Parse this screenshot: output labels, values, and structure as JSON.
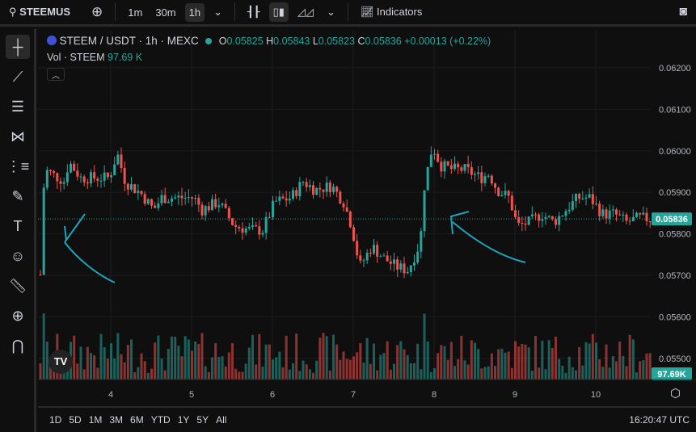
{
  "toolbar": {
    "symbol": "STEEMUS",
    "intervals": [
      "1m",
      "30m",
      "1h"
    ],
    "active_interval": "1h",
    "indicators_label": "Indicators"
  },
  "legend": {
    "title": "STEEM / USDT · 1h · MEXC",
    "o_label": "O",
    "o": "0.05825",
    "h_label": "H",
    "h": "0.05843",
    "l_label": "L",
    "l": "0.05823",
    "c_label": "C",
    "c": "0.05836",
    "change": "+0.00013 (+0.22%)",
    "vol_label": "Vol · STEEM",
    "vol": "97.69 K"
  },
  "left_tools": [
    "crosshair-icon",
    "trendline-icon",
    "fib-icon",
    "pattern-icon",
    "forecast-icon",
    "brush-icon",
    "text-icon",
    "emoji-icon",
    "ruler-icon",
    "zoom-in-icon",
    "magnet-icon"
  ],
  "colors": {
    "up": "#26a69a",
    "down": "#ef5350",
    "annotation": "#1fa3b8",
    "background": "#0f0f0f"
  },
  "chart_data": {
    "type": "candlestick",
    "x_ticks": [
      "4",
      "5",
      "6",
      "7",
      "8",
      "9",
      "10"
    ],
    "y_ticks": [
      "0.06200",
      "0.06100",
      "0.06000",
      "0.05900",
      "0.05800",
      "0.05700",
      "0.05600",
      "0.05500"
    ],
    "ylim": [
      0.0545,
      0.0627
    ],
    "last_price": "0.05836",
    "last_volume": "97.69K",
    "close_path": [
      [
        3.13,
        0.05702
      ],
      [
        3.18,
        0.05955
      ],
      [
        3.43,
        0.05926
      ],
      [
        3.48,
        0.05974
      ],
      [
        3.63,
        0.05935
      ],
      [
        3.98,
        0.05935
      ],
      [
        4.08,
        0.05994
      ],
      [
        4.18,
        0.05926
      ],
      [
        4.38,
        0.05896
      ],
      [
        4.53,
        0.05858
      ],
      [
        4.63,
        0.05887
      ],
      [
        5.03,
        0.05887
      ],
      [
        5.13,
        0.05858
      ],
      [
        5.33,
        0.05877
      ],
      [
        5.53,
        0.05819
      ],
      [
        5.73,
        0.05809
      ],
      [
        5.88,
        0.05809
      ],
      [
        6.03,
        0.05877
      ],
      [
        6.23,
        0.05887
      ],
      [
        6.38,
        0.05926
      ],
      [
        6.53,
        0.05906
      ],
      [
        6.73,
        0.05916
      ],
      [
        6.88,
        0.05877
      ],
      [
        6.98,
        0.05819
      ],
      [
        7.08,
        0.05721
      ],
      [
        7.23,
        0.0577
      ],
      [
        7.38,
        0.05741
      ],
      [
        7.53,
        0.05721
      ],
      [
        7.68,
        0.05712
      ],
      [
        7.83,
        0.0578
      ],
      [
        7.88,
        0.05916
      ],
      [
        7.98,
        0.06013
      ],
      [
        8.08,
        0.05965
      ],
      [
        8.23,
        0.05955
      ],
      [
        8.38,
        0.05955
      ],
      [
        8.58,
        0.05935
      ],
      [
        8.68,
        0.05945
      ],
      [
        8.78,
        0.05906
      ],
      [
        8.93,
        0.05887
      ],
      [
        9.03,
        0.05819
      ],
      [
        9.18,
        0.05828
      ],
      [
        9.33,
        0.05848
      ],
      [
        9.48,
        0.05828
      ],
      [
        9.63,
        0.05858
      ],
      [
        9.78,
        0.05887
      ],
      [
        9.93,
        0.05887
      ],
      [
        10.08,
        0.05848
      ],
      [
        10.23,
        0.05848
      ],
      [
        10.38,
        0.05828
      ],
      [
        10.53,
        0.05838
      ],
      [
        10.68,
        0.05836
      ]
    ]
  },
  "range_buttons": [
    "1D",
    "5D",
    "1M",
    "3M",
    "6M",
    "YTD",
    "1Y",
    "5Y",
    "All"
  ],
  "clock": "16:20:47 UTC"
}
